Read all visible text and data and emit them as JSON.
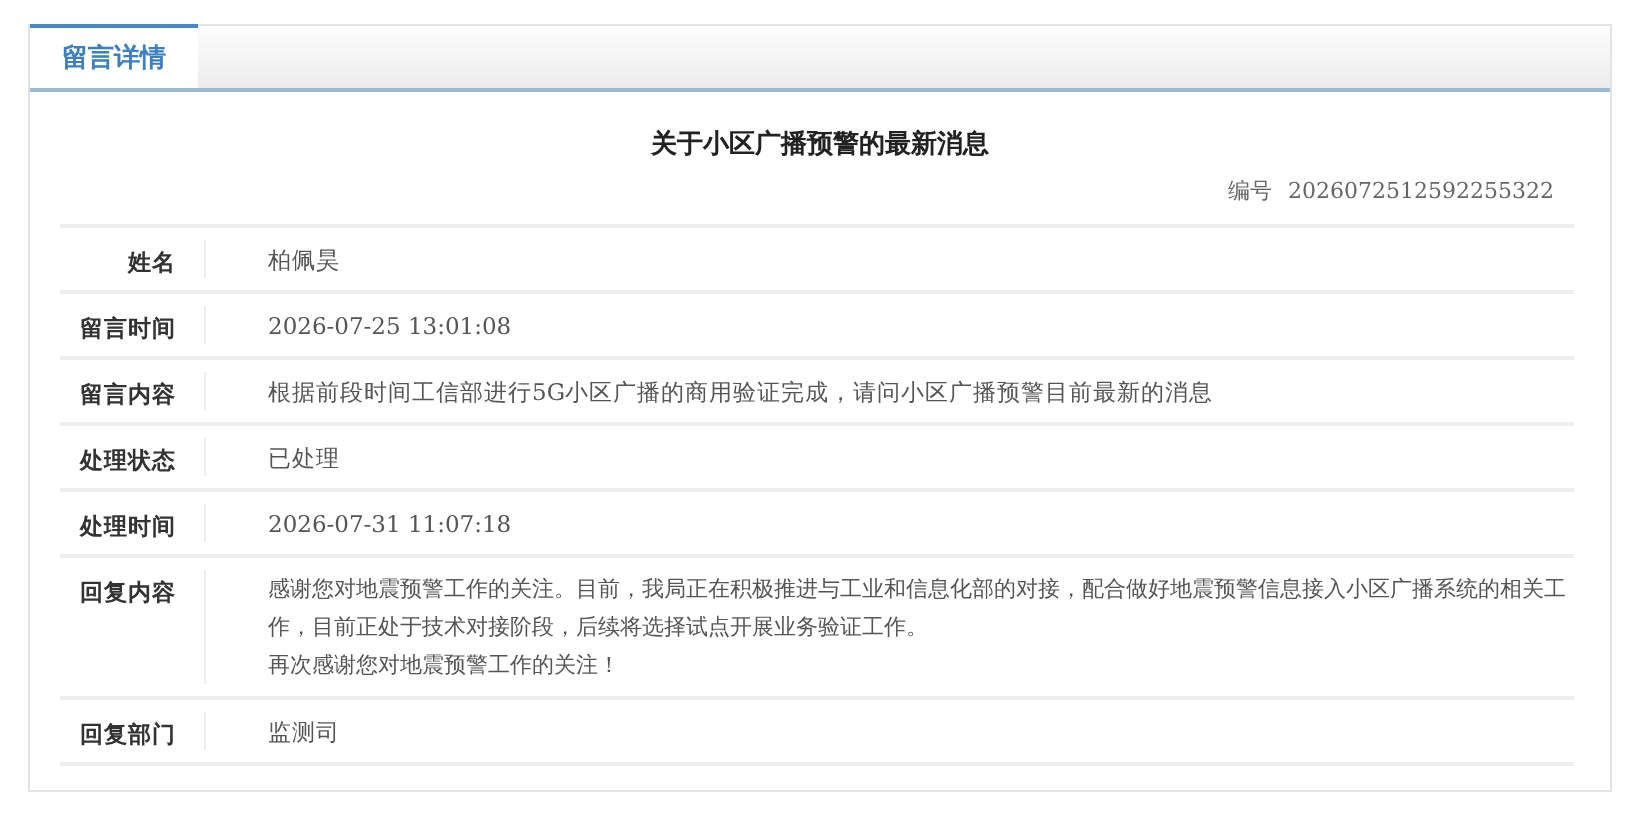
{
  "tabs": [
    {
      "label": "留言详情",
      "selected": true
    }
  ],
  "title": "关于小区广播预警的最新消息",
  "number": {
    "label": "编号",
    "value": "2026072512592255322"
  },
  "rows": [
    {
      "kind": "text",
      "label": "姓名",
      "value": "柏佩昊"
    },
    {
      "kind": "text",
      "label": "留言时间",
      "value": "2026-07-25 13:01:08"
    },
    {
      "kind": "text",
      "label": "留言内容",
      "value": "根据前段时间工信部进行5G小区广播的商用验证完成，请问小区广播预警目前最新的消息"
    },
    {
      "kind": "text",
      "label": "处理状态",
      "value": "已处理"
    },
    {
      "kind": "text",
      "label": "处理时间",
      "value": "2026-07-31 11:07:18"
    },
    {
      "kind": "paragraphs",
      "label": "回复内容",
      "paragraphs": [
        "感谢您对地震预警工作的关注。目前，我局正在积极推进与工业和信息化部的对接，配合做好地震预警信息接入小区广播系统的相关工作，目前正处于技术对接阶段，后续将选择试点开展业务验证工作。",
        "再次感谢您对地震预警工作的关注！"
      ]
    },
    {
      "kind": "text",
      "label": "回复部门",
      "value": "监测司"
    }
  ]
}
